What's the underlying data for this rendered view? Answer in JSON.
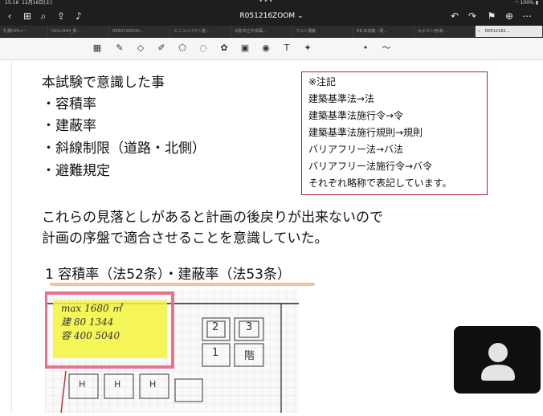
{
  "status_bar": {
    "time": "15:16",
    "date": "12月16日(土)",
    "battery": "100%"
  },
  "header": {
    "doc_title": "R051216ZOOM ⌄"
  },
  "tabs": [
    {
      "label": "札幌H25+ー"
    },
    {
      "label": "H21>R04_新…"
    },
    {
      "label": "R050729ZOO…"
    },
    {
      "label": "ミニコンパクト建…"
    },
    {
      "label": "日影市立中央図…"
    },
    {
      "label": "ウスト講義"
    },
    {
      "label": "RE:本試験・問…"
    },
    {
      "label": "大ボスト用(新…"
    },
    {
      "label": "R0512162…"
    }
  ],
  "content": {
    "intro_title": "本試験で意識した事",
    "bullets": [
      "・容積率",
      "・建蔽率",
      "・斜線制限（道路・北側）",
      "・避難規定"
    ],
    "paragraph_line1": "これらの見落としがあると計画の後戻りが出来ないので",
    "paragraph_line2": "計画の序盤で適合させることを意識していた。",
    "section_heading": "1 容積率（法52条）・建蔽率（法53条）"
  },
  "note": {
    "lines": [
      "※注記",
      "建築基準法→法",
      "建築基準法施行令→令",
      "建築基準法施行規則→規則",
      "バリアフリー法→バ法",
      "バリアフリー法施行令→バ令",
      "それぞれ略称で表記しています。"
    ]
  },
  "sketch": {
    "lines": [
      "max 1680 ㎡",
      "建 80 1344",
      "容 400 5040"
    ],
    "room_labels": [
      "2",
      "3",
      "1",
      "階",
      "H",
      "H",
      "H"
    ]
  },
  "colors": {
    "note_border": "#b8202a",
    "underline": "#f2c49b",
    "highlight": "#f5f53c",
    "pink_box": "#e8738a"
  }
}
